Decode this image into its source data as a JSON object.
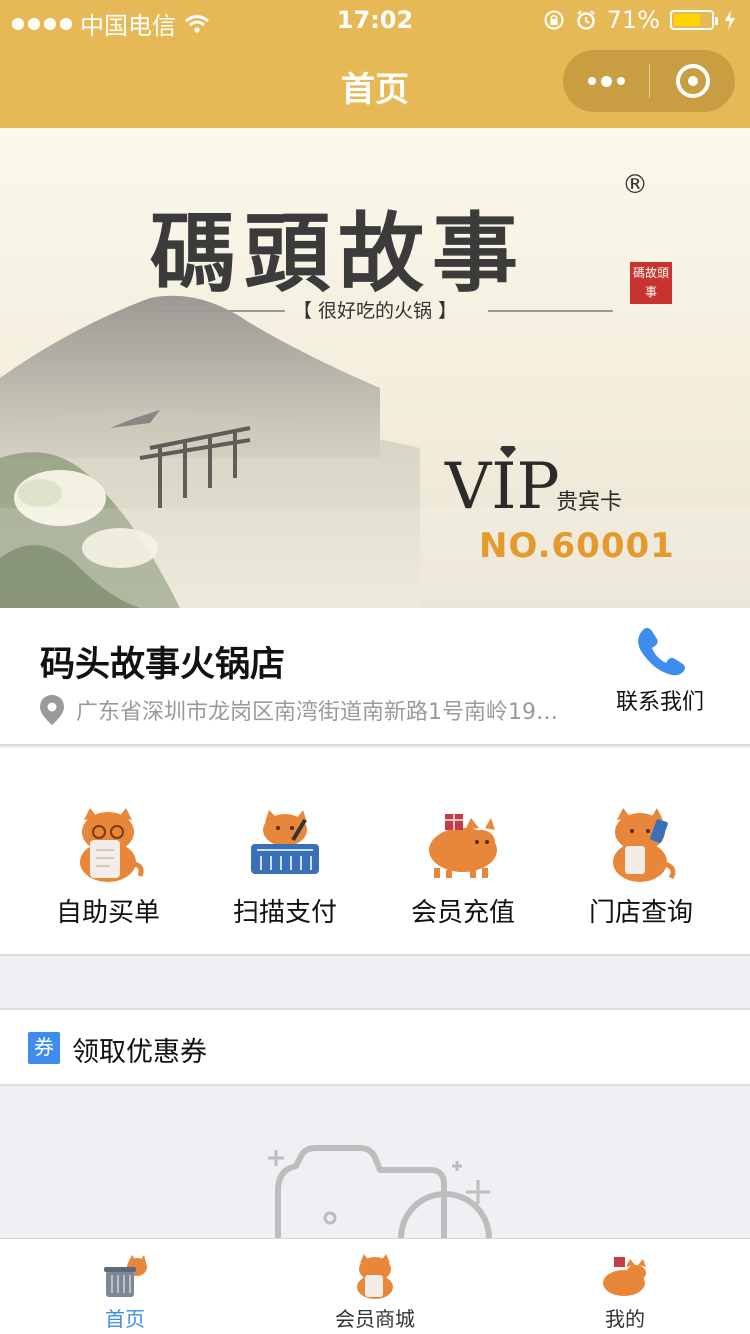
{
  "status_bar": {
    "carrier": "中国电信",
    "time": "17:02",
    "battery": "71%",
    "battery_level": 0.71
  },
  "nav": {
    "title": "首页"
  },
  "banner": {
    "brand": "碼頭故事",
    "registered": "®",
    "slogan": "【 很好吃的火锅 】",
    "seal": "碼故頭事",
    "vip": "VIP",
    "vip_card": "贵宾卡",
    "card_no": "NO.60001"
  },
  "store": {
    "name": "码头故事火锅店",
    "address": "广东省深圳市龙岗区南湾街道南新路1号南岭198...",
    "contact_label": "联系我们"
  },
  "menu": [
    {
      "label": "自助买单",
      "icon": "cat-receipt-icon"
    },
    {
      "label": "扫描支付",
      "icon": "cat-basket-icon"
    },
    {
      "label": "会员充值",
      "icon": "cat-gift-icon"
    },
    {
      "label": "门店查询",
      "icon": "cat-phone-icon"
    }
  ],
  "coupon": {
    "badge": "券",
    "title": "领取优惠券"
  },
  "tabbar": [
    {
      "label": "首页",
      "active": true
    },
    {
      "label": "会员商城",
      "active": false
    },
    {
      "label": "我的",
      "active": false
    }
  ],
  "colors": {
    "theme": "#e7b956",
    "accent_blue": "#3e8ded",
    "cat_orange": "#e8873a",
    "card_no": "#e49a2c"
  }
}
